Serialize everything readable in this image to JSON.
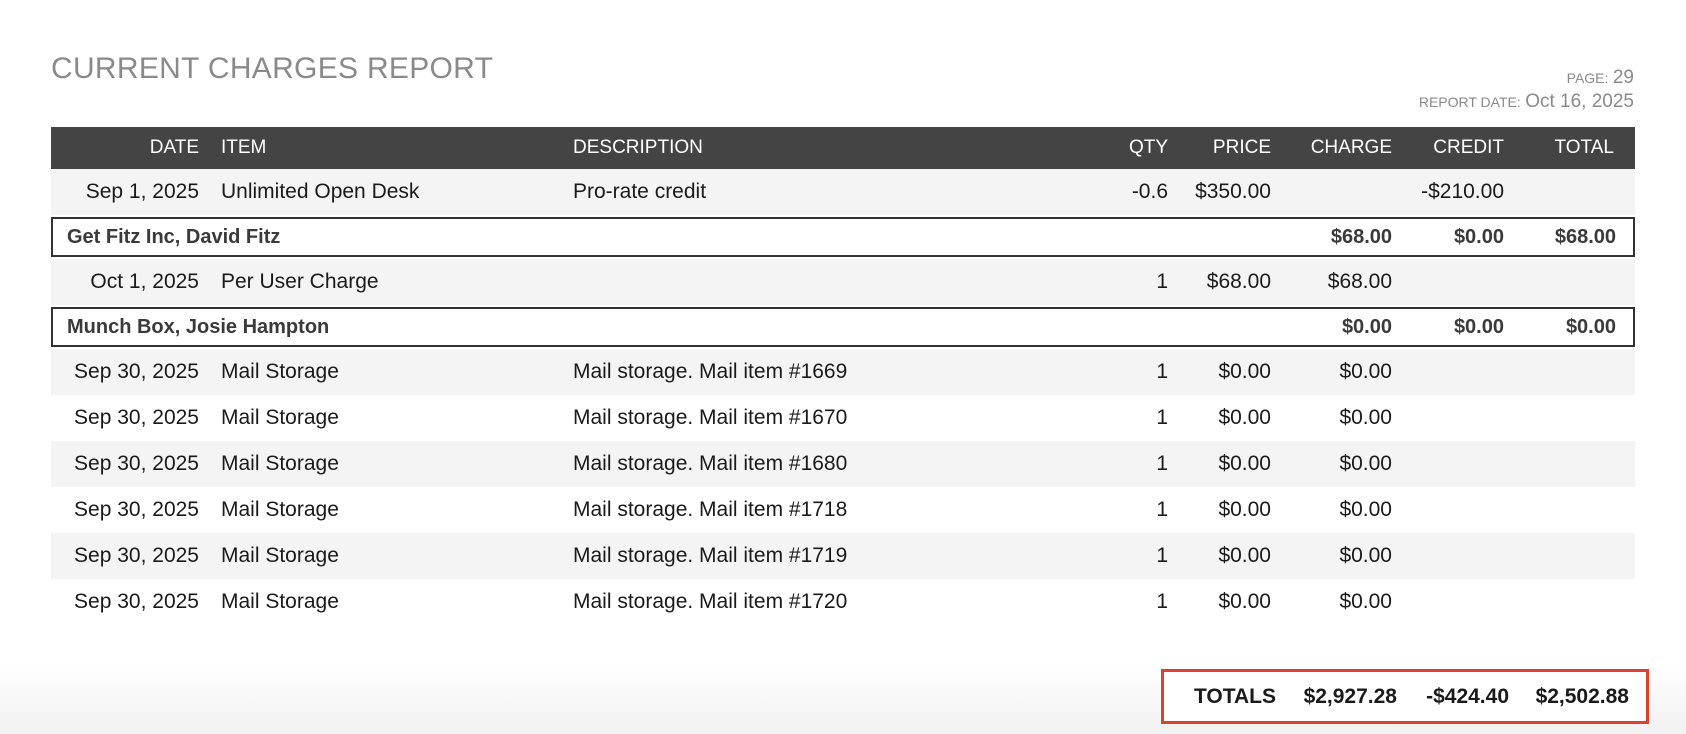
{
  "report": {
    "title": "CURRENT CHARGES REPORT",
    "page_label": "PAGE:",
    "page_value": "29",
    "date_label": "REPORT DATE:",
    "date_value": "Oct 16, 2025"
  },
  "columns": {
    "date": "DATE",
    "item": "ITEM",
    "description": "DESCRIPTION",
    "qty": "QTY",
    "price": "PRICE",
    "charge": "CHARGE",
    "credit": "CREDIT",
    "total": "TOTAL"
  },
  "rows": [
    {
      "date": "Sep 1, 2025",
      "item": "Unlimited Open Desk",
      "description": "Pro-rate credit",
      "qty": "-0.6",
      "price": "$350.00",
      "charge": "",
      "credit": "-$210.00",
      "total": ""
    },
    {
      "group": "Get Fitz Inc, David Fitz",
      "charge": "$68.00",
      "credit": "$0.00",
      "total": "$68.00"
    },
    {
      "date": "Oct 1, 2025",
      "item": "Per User Charge",
      "description": "",
      "qty": "1",
      "price": "$68.00",
      "charge": "$68.00",
      "credit": "",
      "total": ""
    },
    {
      "group": "Munch Box, Josie Hampton",
      "charge": "$0.00",
      "credit": "$0.00",
      "total": "$0.00"
    },
    {
      "date": "Sep 30, 2025",
      "item": "Mail Storage",
      "description": "Mail storage. Mail item #1669",
      "qty": "1",
      "price": "$0.00",
      "charge": "$0.00",
      "credit": "",
      "total": ""
    },
    {
      "date": "Sep 30, 2025",
      "item": "Mail Storage",
      "description": "Mail storage. Mail item #1670",
      "qty": "1",
      "price": "$0.00",
      "charge": "$0.00",
      "credit": "",
      "total": ""
    },
    {
      "date": "Sep 30, 2025",
      "item": "Mail Storage",
      "description": "Mail storage. Mail item #1680",
      "qty": "1",
      "price": "$0.00",
      "charge": "$0.00",
      "credit": "",
      "total": ""
    },
    {
      "date": "Sep 30, 2025",
      "item": "Mail Storage",
      "description": "Mail storage. Mail item #1718",
      "qty": "1",
      "price": "$0.00",
      "charge": "$0.00",
      "credit": "",
      "total": ""
    },
    {
      "date": "Sep 30, 2025",
      "item": "Mail Storage",
      "description": "Mail storage. Mail item #1719",
      "qty": "1",
      "price": "$0.00",
      "charge": "$0.00",
      "credit": "",
      "total": ""
    },
    {
      "date": "Sep 30, 2025",
      "item": "Mail Storage",
      "description": "Mail storage. Mail item #1720",
      "qty": "1",
      "price": "$0.00",
      "charge": "$0.00",
      "credit": "",
      "total": ""
    }
  ],
  "totals": {
    "label": "TOTALS",
    "charge": "$2,927.28",
    "credit": "-$424.40",
    "total": "$2,502.88"
  },
  "colors": {
    "header_bg": "#444444",
    "row_shade": "#f4f4f4",
    "totals_border": "#d9432f"
  }
}
